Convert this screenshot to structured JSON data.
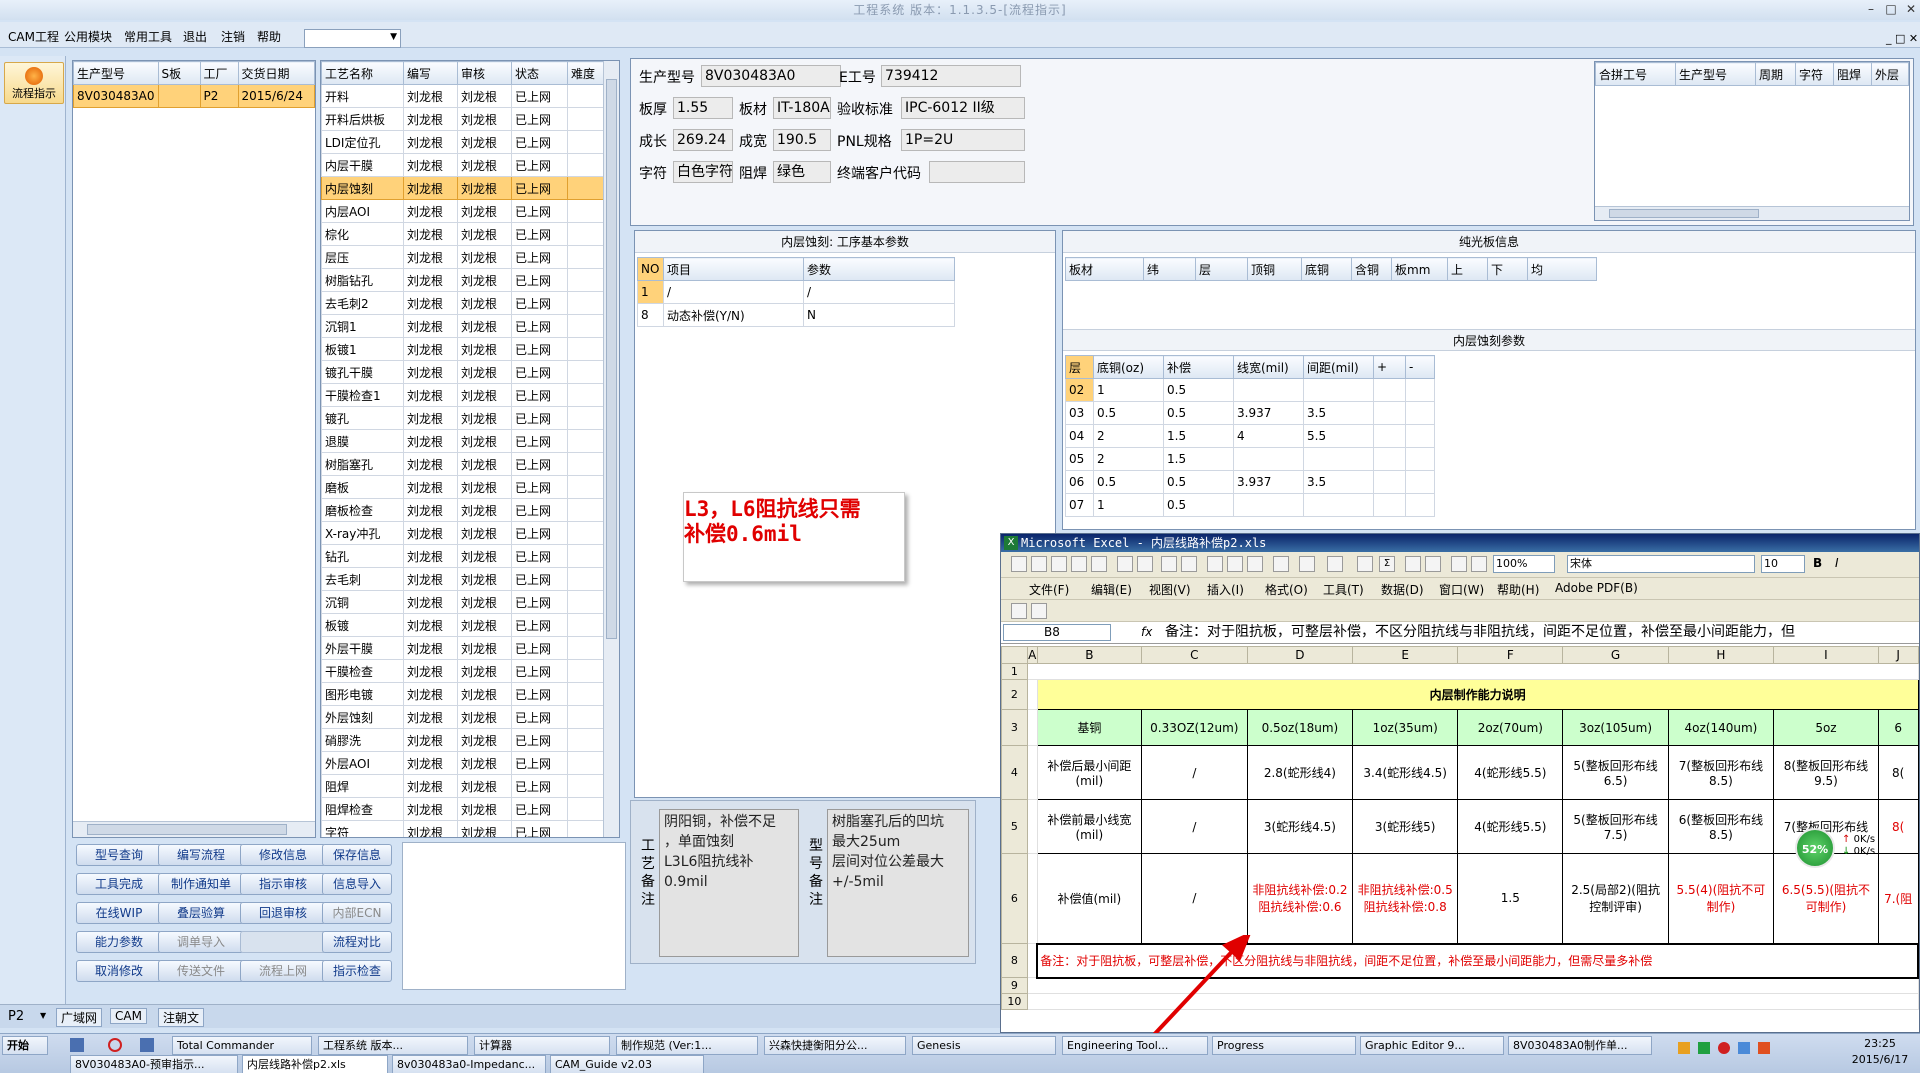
{
  "window": {
    "title": "工程系统 版本：1.1.3.5-[流程指示]",
    "min_icon": "minimize-icon",
    "max_icon": "maximize-icon",
    "close_icon": "close-icon"
  },
  "menu": {
    "items": [
      "CAM工程",
      "公用模块",
      "常用工具",
      "退出",
      "注销",
      "帮助"
    ]
  },
  "nav": {
    "label": "流程指示"
  },
  "orders": {
    "headers": [
      "生产型号",
      "S板",
      "工厂",
      "交货日期"
    ],
    "rows": [
      [
        "8V030483A0",
        "",
        "P2",
        "2015/6/24"
      ]
    ]
  },
  "process": {
    "headers": [
      "工艺名称",
      "编写",
      "审核",
      "状态",
      "难度"
    ],
    "rows": [
      [
        "开料",
        "刘龙根",
        "刘龙根",
        "已上网"
      ],
      [
        "开料后烘板",
        "刘龙根",
        "刘龙根",
        "已上网"
      ],
      [
        "LDI定位孔",
        "刘龙根",
        "刘龙根",
        "已上网"
      ],
      [
        "内层干膜",
        "刘龙根",
        "刘龙根",
        "已上网"
      ],
      [
        "内层蚀刻",
        "刘龙根",
        "刘龙根",
        "已上网"
      ],
      [
        "内层AOI",
        "刘龙根",
        "刘龙根",
        "已上网"
      ],
      [
        "棕化",
        "刘龙根",
        "刘龙根",
        "已上网"
      ],
      [
        "层压",
        "刘龙根",
        "刘龙根",
        "已上网"
      ],
      [
        "树脂钻孔",
        "刘龙根",
        "刘龙根",
        "已上网"
      ],
      [
        "去毛刺2",
        "刘龙根",
        "刘龙根",
        "已上网"
      ],
      [
        "沉铜1",
        "刘龙根",
        "刘龙根",
        "已上网"
      ],
      [
        "板镀1",
        "刘龙根",
        "刘龙根",
        "已上网"
      ],
      [
        "镀孔干膜",
        "刘龙根",
        "刘龙根",
        "已上网"
      ],
      [
        "干膜检查1",
        "刘龙根",
        "刘龙根",
        "已上网"
      ],
      [
        "镀孔",
        "刘龙根",
        "刘龙根",
        "已上网"
      ],
      [
        "退膜",
        "刘龙根",
        "刘龙根",
        "已上网"
      ],
      [
        "树脂塞孔",
        "刘龙根",
        "刘龙根",
        "已上网"
      ],
      [
        "磨板",
        "刘龙根",
        "刘龙根",
        "已上网"
      ],
      [
        "磨板检查",
        "刘龙根",
        "刘龙根",
        "已上网"
      ],
      [
        "X-ray冲孔",
        "刘龙根",
        "刘龙根",
        "已上网"
      ],
      [
        "钻孔",
        "刘龙根",
        "刘龙根",
        "已上网"
      ],
      [
        "去毛刺",
        "刘龙根",
        "刘龙根",
        "已上网"
      ],
      [
        "沉铜",
        "刘龙根",
        "刘龙根",
        "已上网"
      ],
      [
        "板镀",
        "刘龙根",
        "刘龙根",
        "已上网"
      ],
      [
        "外层干膜",
        "刘龙根",
        "刘龙根",
        "已上网"
      ],
      [
        "干膜检查",
        "刘龙根",
        "刘龙根",
        "已上网"
      ],
      [
        "图形电镀",
        "刘龙根",
        "刘龙根",
        "已上网"
      ],
      [
        "外层蚀刻",
        "刘龙根",
        "刘龙根",
        "已上网"
      ],
      [
        "硝膠洗",
        "刘龙根",
        "刘龙根",
        "已上网"
      ],
      [
        "外层AOI",
        "刘龙根",
        "刘龙根",
        "已上网"
      ],
      [
        "阻焊",
        "刘龙根",
        "刘龙根",
        "已上网"
      ],
      [
        "阻焊检查",
        "刘龙根",
        "刘龙根",
        "已上网"
      ],
      [
        "字符",
        "刘龙根",
        "刘龙根",
        "已上网"
      ]
    ]
  },
  "info": {
    "prod_label": "生产型号",
    "prod": "8V030483A0",
    "e_label": "E工号",
    "e": "739412",
    "thick_label": "板厚",
    "thick": "1.55",
    "mat_label": "板材",
    "mat": "IT-180A",
    "std_label": "验收标准",
    "std": "IPC-6012 II级",
    "len_label": "成长",
    "len": "269.24",
    "wid_label": "成宽",
    "wid": "190.5",
    "pnl_label": "PNL规格",
    "pnl": "1P=2U",
    "char_label": "字符",
    "char": "白色字符",
    "mask_label": "阻焊",
    "mask": "绿色",
    "cust_label": "终端客户代码",
    "cust": ""
  },
  "combine": {
    "headers": [
      "合拼工号",
      "生产型号",
      "周期",
      "字符",
      "阻焊",
      "外层"
    ]
  },
  "params": {
    "title": "内层蚀刻: 工序基本参数",
    "headers": [
      "NO",
      "项目",
      "参数"
    ],
    "rows": [
      [
        "1",
        "/",
        "/"
      ],
      [
        "8",
        "动态补偿(Y/N)",
        "N"
      ]
    ]
  },
  "bare": {
    "title": "纯光板信息",
    "headers": [
      "板材",
      "纬",
      "层",
      "顶铜",
      "底铜",
      "含铜",
      "板mm",
      "上",
      "下",
      "均"
    ]
  },
  "etch": {
    "title": "内层蚀刻参数",
    "headers": [
      "层",
      "底铜(oz)",
      "补偿",
      "线宽(mil)",
      "间距(mil)",
      "+",
      "-"
    ],
    "rows": [
      [
        "02",
        "1",
        "0.5",
        "",
        "",
        "",
        ""
      ],
      [
        "03",
        "0.5",
        "0.5",
        "3.937",
        "3.5",
        "",
        ""
      ],
      [
        "04",
        "2",
        "1.5",
        "4",
        "5.5",
        "",
        ""
      ],
      [
        "05",
        "2",
        "1.5",
        "",
        "",
        "",
        ""
      ],
      [
        "06",
        "0.5",
        "0.5",
        "3.937",
        "3.5",
        "",
        ""
      ],
      [
        "07",
        "1",
        "0.5",
        "",
        "",
        "",
        ""
      ]
    ]
  },
  "callout": {
    "line1": "L3，L6阻抗线只需",
    "line2": "补偿0.6mil"
  },
  "buttons": [
    [
      "型号查询",
      "编写流程",
      "修改信息",
      "保存信息"
    ],
    [
      "工具完成",
      "制作通知单",
      "指示审核",
      "信息导入"
    ],
    [
      "在线WIP",
      "叠层验算",
      "回退审核",
      "内部ECN"
    ],
    [
      "能力参数",
      "调单导入",
      "",
      "流程对比"
    ],
    [
      "取消修改",
      "传送文件",
      "流程上网",
      "指示检查"
    ]
  ],
  "remarks": {
    "proc_label": "工艺备注",
    "proc_lines": [
      "阴阳铜，补偿不足",
      "，单面蚀刻",
      "L3L6阻抗线补",
      "0.9mil"
    ],
    "model_label": "型号备注",
    "model_lines": [
      "树脂塞孔后的凹坑",
      "最大25um",
      "层间对位公差最大",
      "+/-5mil"
    ]
  },
  "bottomtabs": {
    "site": "P2",
    "tabs": [
      "广域网",
      "CAM",
      "注朝文"
    ]
  },
  "excel": {
    "title": "Microsoft Excel - 内层线路补偿p2.xls",
    "menus": [
      "文件(F)",
      "编辑(E)",
      "视图(V)",
      "插入(I)",
      "格式(O)",
      "工具(T)",
      "数据(D)",
      "窗口(W)",
      "帮助(H)",
      "Adobe PDF(B)"
    ],
    "zoom": "100%",
    "font": "宋体",
    "size": "10",
    "cellref": "B8",
    "formula": "备注：对于阻抗板，可整层补偿，不区分阻抗线与非阻抗线，间距不足位置，补偿至最小间距能力，但",
    "cols": [
      "A",
      "B",
      "C",
      "D",
      "E",
      "F",
      "G",
      "H",
      "I",
      "J"
    ],
    "sheet_title": "内层制作能力说明",
    "hdr": [
      "基铜",
      "0.33OZ(12um)",
      "0.5oz(18um)",
      "1oz(35um)",
      "2oz(70um)",
      "3oz(105um)",
      "4oz(140um)",
      "5oz",
      "6"
    ],
    "r4": [
      "补偿后最小间距(mil)",
      "/",
      "2.8(蛇形线4)",
      "3.4(蛇形线4.5)",
      "4(蛇形线5.5)",
      "5(整板回形布线6.5)",
      "7(整板回形布线8.5)",
      "8(整板回形布线9.5)",
      "8("
    ],
    "r5": [
      "补偿前最小线宽(mil)",
      "/",
      "3(蛇形线4.5)",
      "3(蛇形线5)",
      "4(蛇形线5.5)",
      "5(整板回形布线7.5)",
      "6(整板回形布线8.5)",
      "7(整板回形布线",
      "8("
    ],
    "r6": [
      "补偿值(mil)",
      "/",
      "非阻抗线补偿:0.2阻抗线补偿:0.6",
      "非阻抗线补偿:0.5阻抗线补偿:0.8",
      "1.5",
      "2.5(局部2)(阻抗控制评审)",
      "5.5(4)(阻抗不可制作)",
      "6.5(5.5)(阻抗不可制作)",
      "7.(阻"
    ],
    "note": "备注：对于阻抗板，可整层补偿，不区分阻抗线与非阻抗线，间距不足位置，补偿至最小间距能力，但需尽量多补偿",
    "rows": [
      "1",
      "2",
      "3",
      "4",
      "5",
      "6",
      "7",
      "8",
      "9",
      "10"
    ]
  },
  "speed": {
    "pct": "52%",
    "up": "0K/s",
    "down": "0K/s"
  },
  "taskbar": {
    "start": "开始",
    "row1": [
      "Total Commander",
      "工程系统 版本...",
      "计算器",
      "制作规范 (Ver:1...",
      "兴森快捷衡阳分公...",
      "Genesis",
      "Engineering Tool...",
      "Progress",
      "Graphic Editor 9...",
      "8V030483A0制作单..."
    ],
    "row2": [
      "8V030483A0-预审指示...",
      "内层线路补偿p2.xls",
      "8v030483a0-Impedanc...",
      "CAM_Guide v2.03"
    ],
    "time": "23:25",
    "date": "2015/6/17"
  },
  "colors": {
    "accent": "#ffd27a",
    "red": "#e00000",
    "excel_header": "#ccffcc",
    "title_blue": "#0a246a"
  }
}
